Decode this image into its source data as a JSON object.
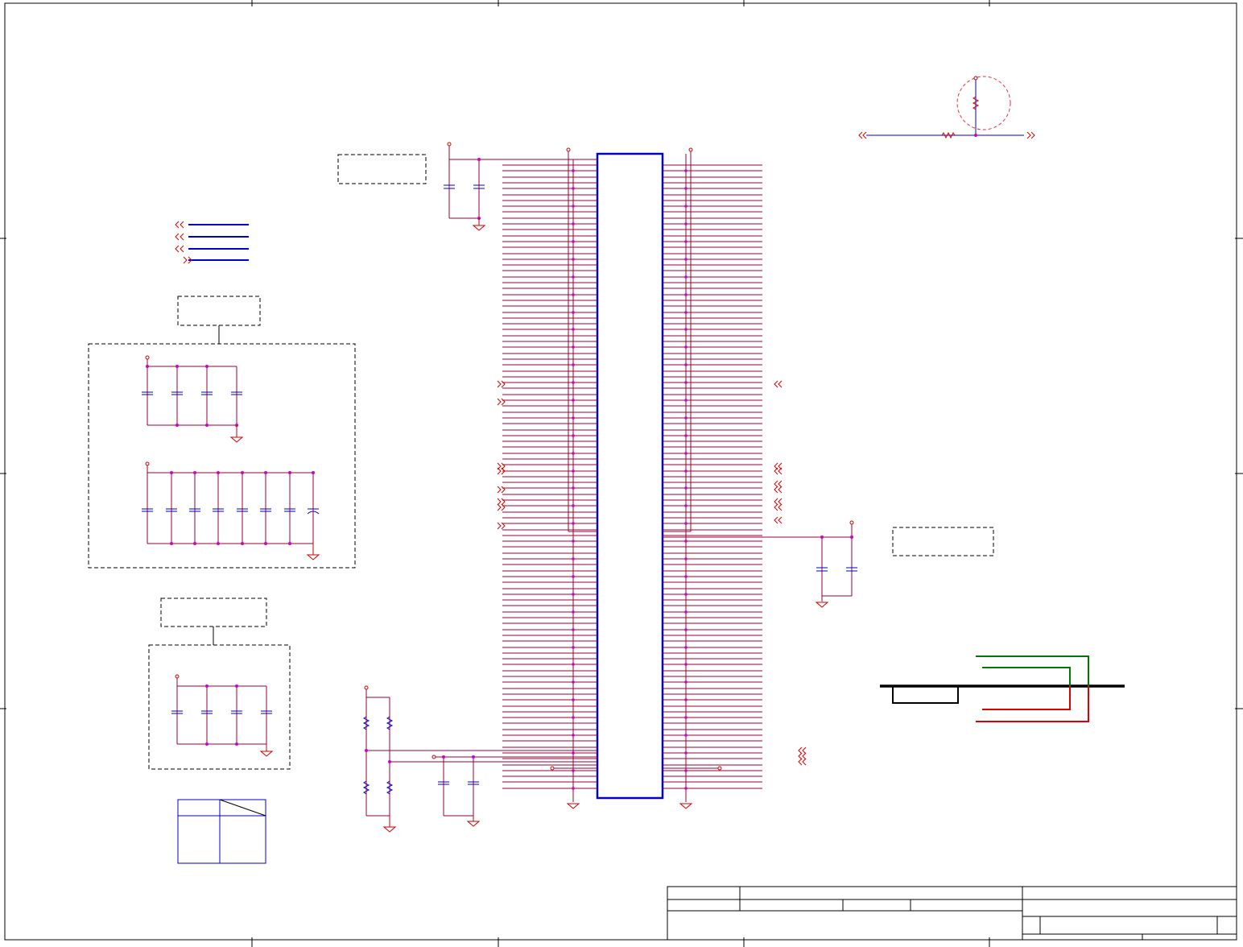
{
  "sheet": {
    "title_block": {
      "row1": [
        "",
        "",
        ""
      ],
      "row2": [
        "",
        "",
        "",
        ""
      ],
      "row3": [
        "",
        "",
        ""
      ]
    },
    "connector_body_color": "#0000cc",
    "wire_color": "#990033",
    "junction_color": "#cc00cc",
    "power_color": "#cc0000",
    "bus_colors": {
      "green": "#007700",
      "red": "#dd0000",
      "black": "#000000"
    }
  }
}
